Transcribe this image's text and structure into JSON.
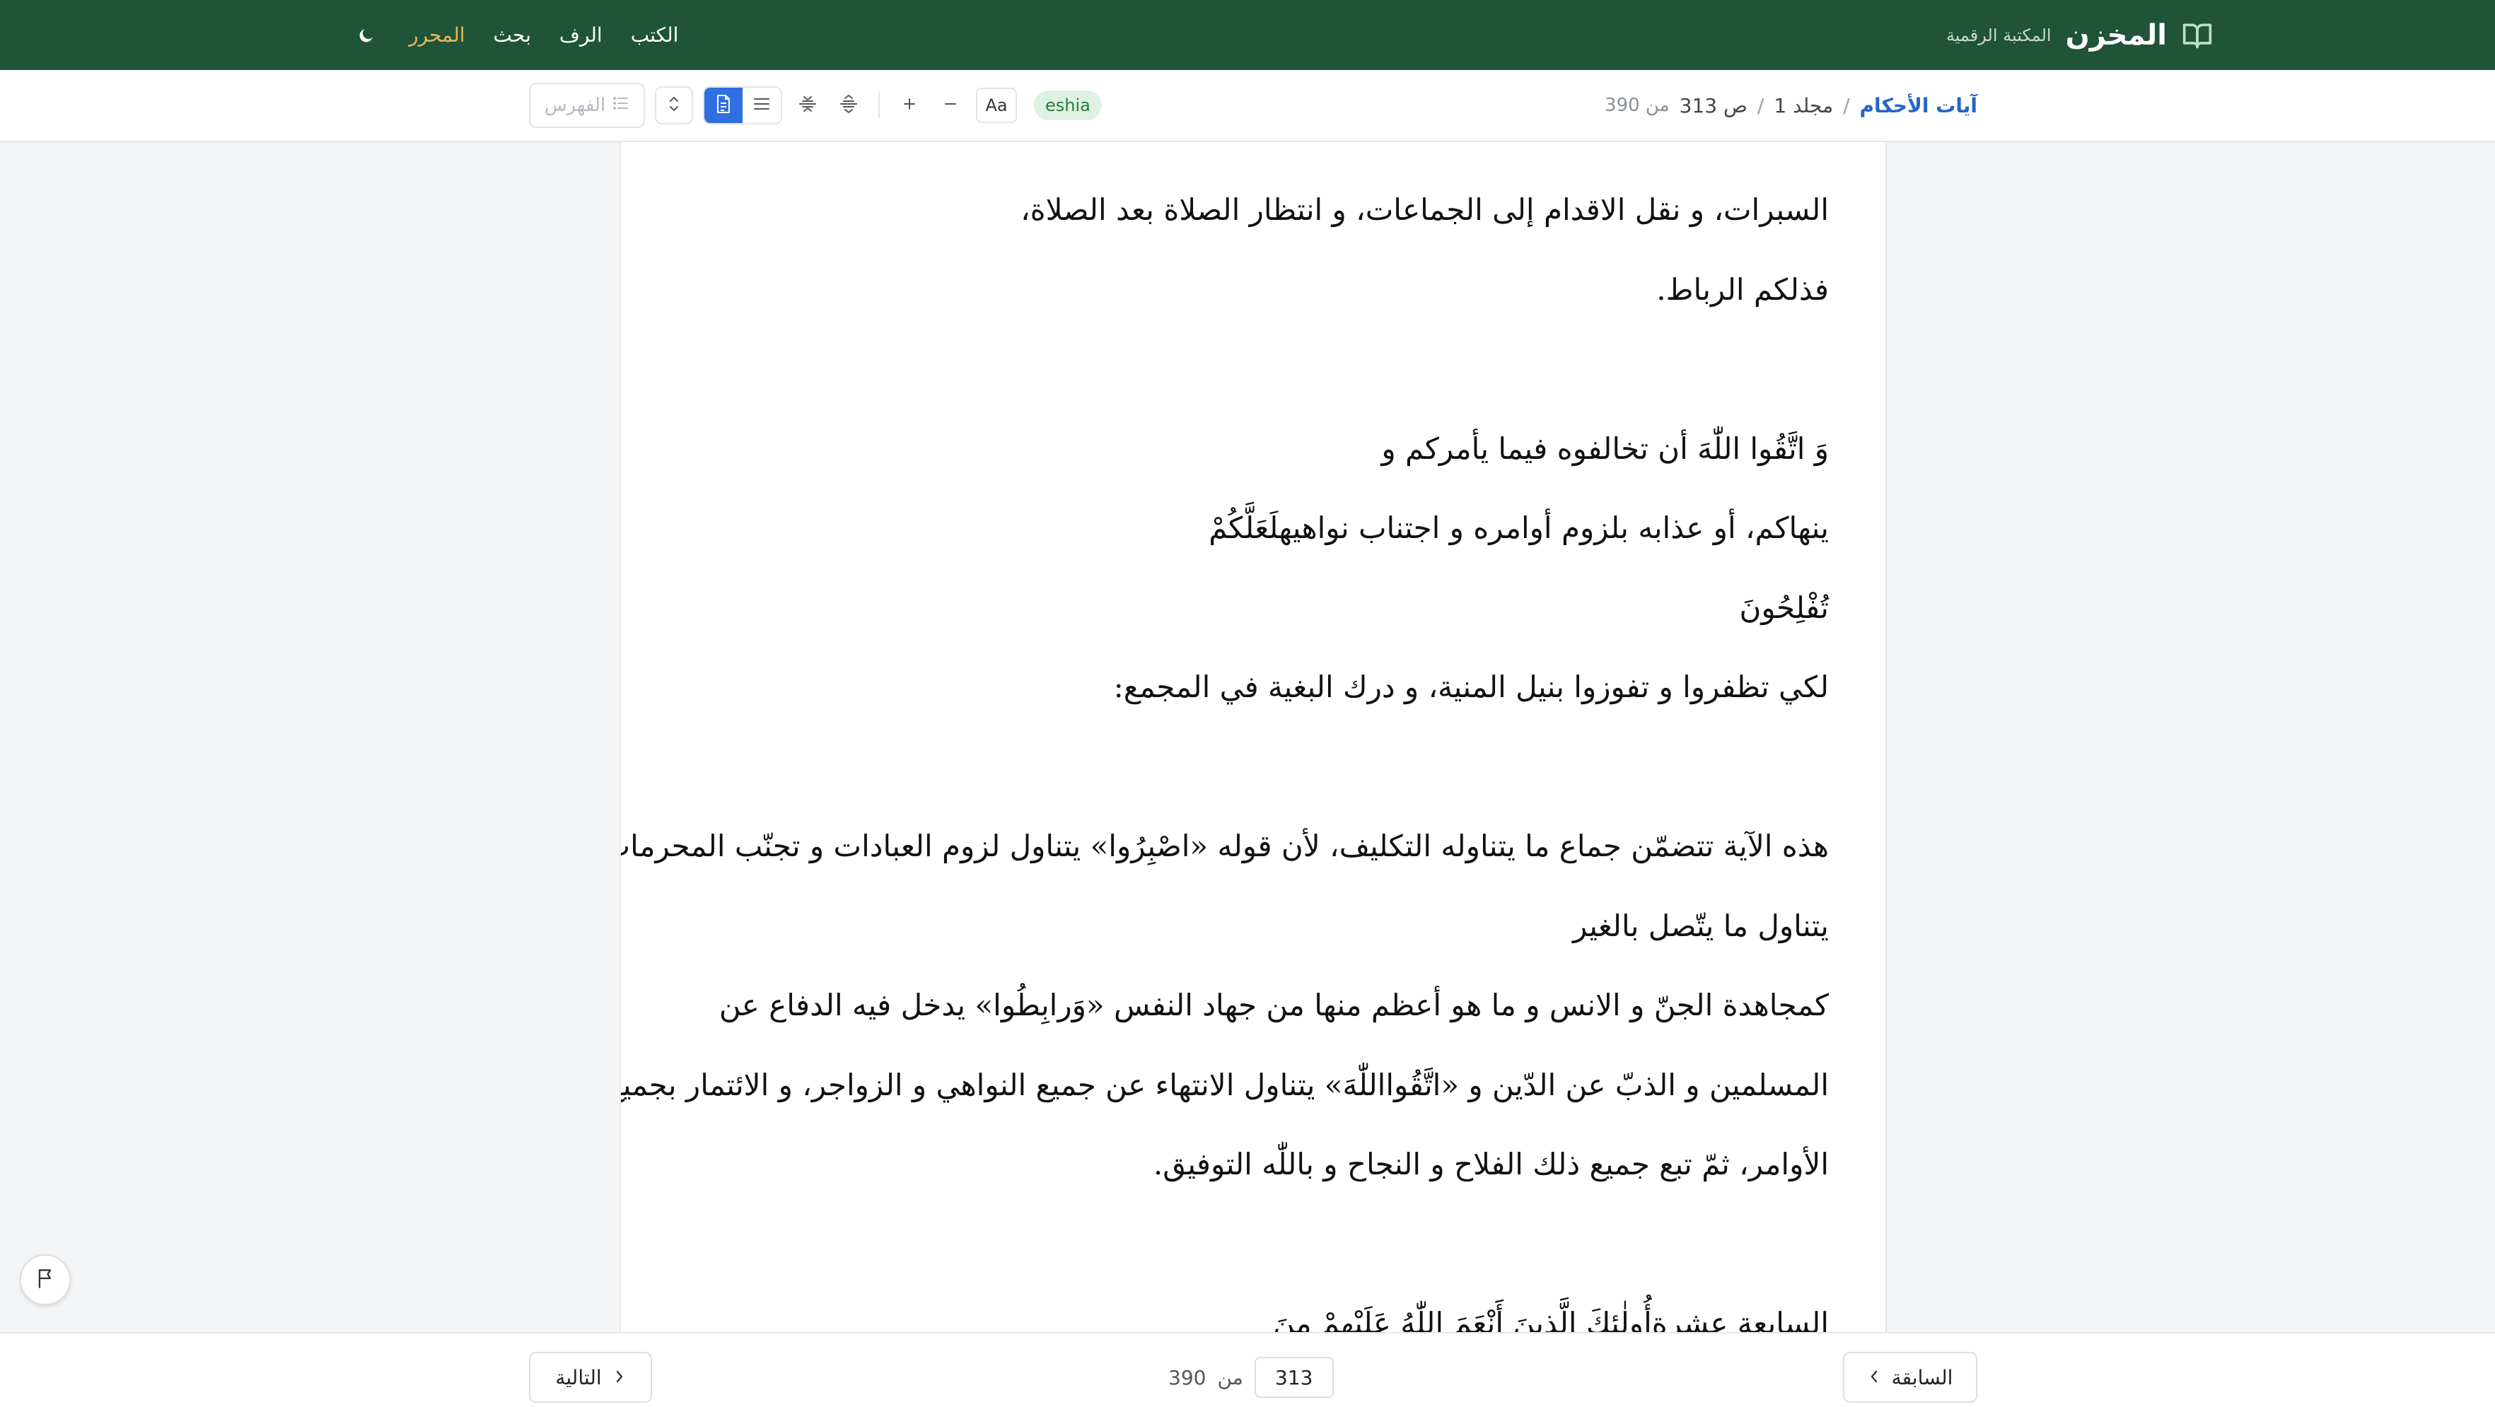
{
  "brand": {
    "title": "المخزن",
    "subtitle": "المكتبة الرقمية"
  },
  "nav": {
    "items": [
      "الكتب",
      "الرف",
      "بحث",
      "المحرر"
    ],
    "active_index": 3,
    "theme_toggle_icon": "moon-icon"
  },
  "toolbar": {
    "breadcrumb": {
      "book": "آيات الأحكام",
      "separator": "/",
      "volume": "مجلد 1",
      "page": "ص 313",
      "total": "من 390"
    },
    "source_badge": "eshia",
    "font_button": "Aa",
    "toc_label": "الفهرس",
    "active_view": "page"
  },
  "content": {
    "lines": [
      "السبرات، و نقل الاقدام إلى الجماعات، و انتظار الصلاة بعد الصلاة،",
      "فذلكم الرباط.",
      "",
      "وَ اتَّقُوا اللّٰهَ أن تخالفوه فيما يأمركم و",
      "ينهاكم، أو عذابه بلزوم أوامره و اجتناب نواهيهلَعَلَّكُمْ",
      "تُفْلِحُونَ",
      "لكي تظفروا و تفوزوا بنيل المنية، و درك البغية في المجمع:",
      "",
      "هذه الآية تتضمّن جماع ما يتناوله التكليف، لأن قوله «اصْبِرُوا» يتناول لزوم العبادات و تجنّب المحرمات «وَصابِرُوا»",
      "يتناول ما يتّصل بالغير",
      "كمجاهدة الجنّ و الانس و ما هو أعظم منها من جهاد النفس «وَرابِطُوا» يدخل فيه الدفاع عن",
      "المسلمين و الذبّ عن الدّين و «اتَّقُوااللّٰهَ» يتناول الانتهاء عن جميع النواهي و الزواجر، و الائتمار بجميع",
      "الأوامر، ثمّ تبع جميع ذلك الفلاح و النجاح و باللّٰه التوفيق.",
      "",
      "السابعة عشرةأُولٰئِكَ الَّذِينَ أَنْعَمَ اللّٰهُ عَلَيْهِمْ مِنَ"
    ]
  },
  "pager": {
    "prev_label": "السابقة",
    "next_label": "التالية",
    "current_page": "313",
    "of_label": "من",
    "total_pages": "390"
  },
  "colors": {
    "header_bg": "#1f5439",
    "nav_active": "#e5b75a",
    "breadcrumb_link": "#2563c8",
    "view_active": "#2f6fe0",
    "badge_bg": "#dff1e3",
    "badge_text": "#2b7a3f"
  }
}
